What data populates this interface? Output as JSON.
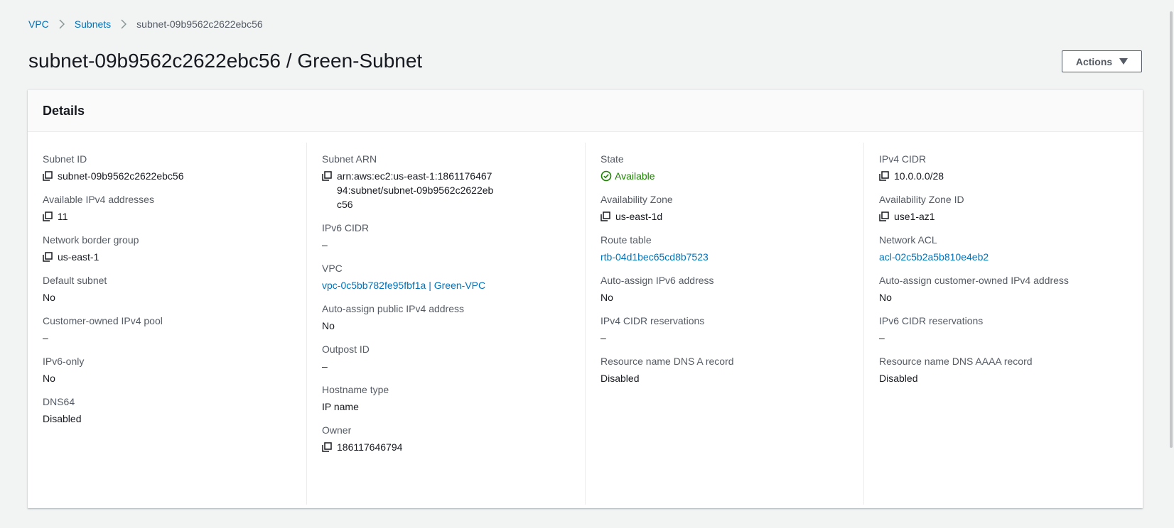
{
  "breadcrumb": {
    "items": [
      "VPC",
      "Subnets"
    ],
    "current": "subnet-09b9562c2622ebc56"
  },
  "page_title": "subnet-09b9562c2622ebc56 / Green-Subnet",
  "actions_label": "Actions",
  "details": {
    "title": "Details",
    "col1": {
      "subnet_id_label": "Subnet ID",
      "subnet_id": "subnet-09b9562c2622ebc56",
      "available_ipv4_label": "Available IPv4 addresses",
      "available_ipv4": "11",
      "network_border_group_label": "Network border group",
      "network_border_group": "us-east-1",
      "default_subnet_label": "Default subnet",
      "default_subnet": "No",
      "customer_owned_pool_label": "Customer-owned IPv4 pool",
      "customer_owned_pool": "–",
      "ipv6_only_label": "IPv6-only",
      "ipv6_only": "No",
      "dns64_label": "DNS64",
      "dns64": "Disabled"
    },
    "col2": {
      "subnet_arn_label": "Subnet ARN",
      "subnet_arn": "arn:aws:ec2:us-east-1:186117646794:subnet/subnet-09b9562c2622ebc56",
      "ipv6_cidr_label": "IPv6 CIDR",
      "ipv6_cidr": "–",
      "vpc_label": "VPC",
      "vpc": "vpc-0c5bb782fe95fbf1a | Green-VPC",
      "auto_assign_public_ipv4_label": "Auto-assign public IPv4 address",
      "auto_assign_public_ipv4": "No",
      "outpost_id_label": "Outpost ID",
      "outpost_id": "–",
      "hostname_type_label": "Hostname type",
      "hostname_type": "IP name",
      "owner_label": "Owner",
      "owner": "186117646794"
    },
    "col3": {
      "state_label": "State",
      "state": "Available",
      "availability_zone_label": "Availability Zone",
      "availability_zone": "us-east-1d",
      "route_table_label": "Route table",
      "route_table": "rtb-04d1bec65cd8b7523",
      "auto_assign_ipv6_label": "Auto-assign IPv6 address",
      "auto_assign_ipv6": "No",
      "ipv4_cidr_reservations_label": "IPv4 CIDR reservations",
      "ipv4_cidr_reservations": "–",
      "dns_a_record_label": "Resource name DNS A record",
      "dns_a_record": "Disabled"
    },
    "col4": {
      "ipv4_cidr_label": "IPv4 CIDR",
      "ipv4_cidr": "10.0.0.0/28",
      "availability_zone_id_label": "Availability Zone ID",
      "availability_zone_id": "use1-az1",
      "network_acl_label": "Network ACL",
      "network_acl": "acl-02c5b2a5b810e4eb2",
      "auto_assign_customer_owned_label": "Auto-assign customer-owned IPv4 address",
      "auto_assign_customer_owned": "No",
      "ipv6_cidr_reservations_label": "IPv6 CIDR reservations",
      "ipv6_cidr_reservations": "–",
      "dns_aaaa_record_label": "Resource name DNS AAAA record",
      "dns_aaaa_record": "Disabled"
    }
  },
  "icons": {
    "copy": "copy-icon",
    "status_ok": "status-positive-icon",
    "breadcrumb_separator": "chevron-right-icon",
    "dropdown": "caret-down-icon"
  },
  "colors": {
    "link": "#0073bb",
    "success": "#1d8102",
    "background": "#f2f3f3"
  }
}
